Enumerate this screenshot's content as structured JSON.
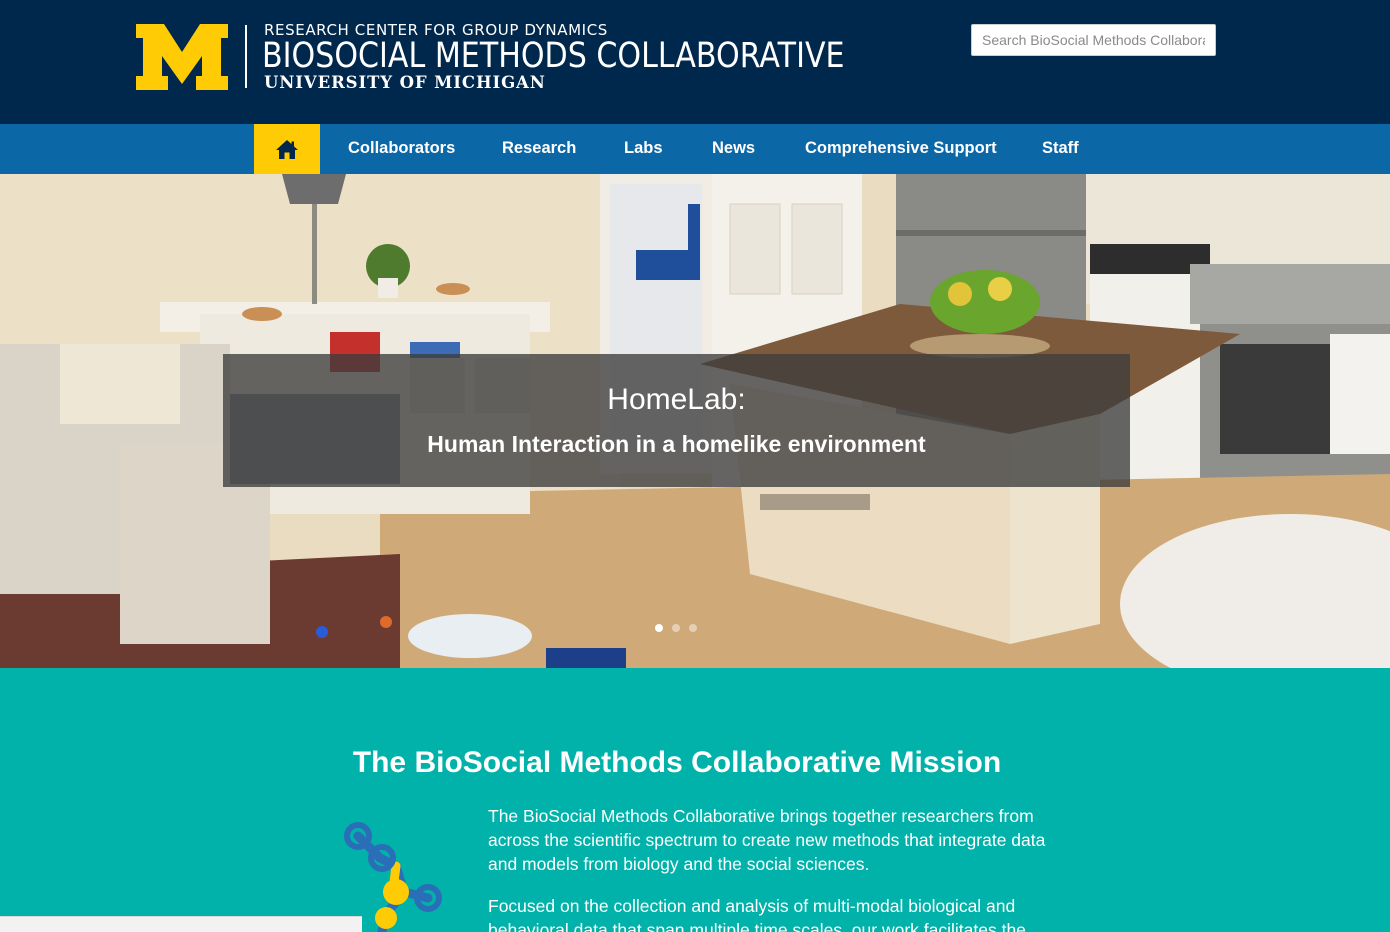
{
  "header": {
    "logo_line1": "RESEARCH CENTER FOR GROUP DYNAMICS",
    "logo_line2": "BIOSOCIAL METHODS COLLABORATIVE",
    "logo_line3": "UNIVERSITY OF MICHIGAN",
    "search_placeholder": "Search BioSocial Methods Collaborative",
    "brand_blue": "#00274c",
    "maize": "#ffcb05"
  },
  "nav": {
    "home_icon": "home-icon",
    "items": [
      {
        "label": "Collaborators"
      },
      {
        "label": "Research"
      },
      {
        "label": "Labs"
      },
      {
        "label": "News"
      },
      {
        "label": "Comprehensive Support"
      },
      {
        "label": "Staff"
      }
    ],
    "bar_color": "#0c67a7"
  },
  "hero": {
    "caption_title": "HomeLab:",
    "caption_subtitle": "Human Interaction in a homelike environment",
    "slide_count": 3,
    "active_slide": 1
  },
  "mission": {
    "title": "The BioSocial Methods Collaborative Mission",
    "paragraph1": "The BioSocial Methods Collaborative brings together researchers from across the scientific spectrum to create new methods that integrate data and models from biology and the social sciences.",
    "paragraph2": "Focused on the collection and analysis of multi-modal biological and behavioral data that span multiple time scales, our work facilitates the",
    "background": "#00b2a9"
  }
}
